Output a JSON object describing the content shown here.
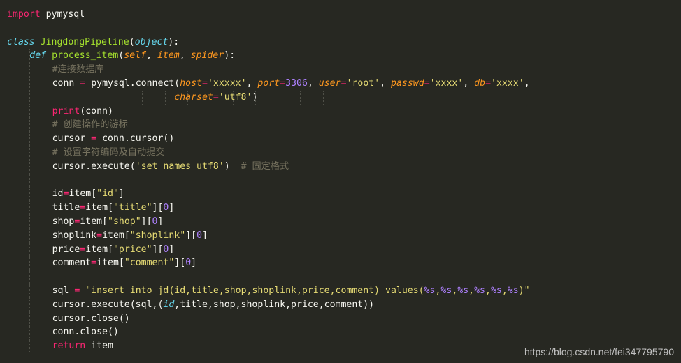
{
  "editor": {
    "theme_colors": {
      "background": "#272822",
      "default_text": "#f8f8f2",
      "keyword": "#f92672",
      "storage_type": "#66d9ef",
      "function_name": "#a6e22e",
      "parameter": "#fd971f",
      "string": "#e6db74",
      "number": "#ae81ff",
      "comment": "#75715e"
    },
    "lines": [
      {
        "indent": 0,
        "tokens": [
          [
            "kw",
            "import"
          ],
          [
            "txt",
            " pymysql"
          ]
        ]
      },
      {
        "indent": 0,
        "tokens": []
      },
      {
        "indent": 0,
        "tokens": [
          [
            "kwi",
            "class"
          ],
          [
            "txt",
            " "
          ],
          [
            "fn",
            "JingdongPipeline"
          ],
          [
            "txt",
            "("
          ],
          [
            "kwi",
            "object"
          ],
          [
            "txt",
            "):"
          ]
        ]
      },
      {
        "indent": 1,
        "tokens": [
          [
            "kwi",
            "def"
          ],
          [
            "txt",
            " "
          ],
          [
            "fn",
            "process_item"
          ],
          [
            "txt",
            "("
          ],
          [
            "par",
            "self"
          ],
          [
            "txt",
            ", "
          ],
          [
            "par",
            "item"
          ],
          [
            "txt",
            ", "
          ],
          [
            "par",
            "spider"
          ],
          [
            "txt",
            "):"
          ]
        ]
      },
      {
        "indent": 2,
        "tokens": [
          [
            "cmt",
            "#连接数据库"
          ]
        ]
      },
      {
        "indent": 2,
        "tokens": [
          [
            "txt",
            "conn "
          ],
          [
            "kw",
            "="
          ],
          [
            "txt",
            " pymysql.connect("
          ],
          [
            "par",
            "host"
          ],
          [
            "kw",
            "="
          ],
          [
            "str",
            "'xxxxx'"
          ],
          [
            "txt",
            ", "
          ],
          [
            "par",
            "port"
          ],
          [
            "kw",
            "="
          ],
          [
            "num",
            "3306"
          ],
          [
            "txt",
            ", "
          ],
          [
            "par",
            "user"
          ],
          [
            "kw",
            "="
          ],
          [
            "str",
            "'root'"
          ],
          [
            "txt",
            ", "
          ],
          [
            "par",
            "passwd"
          ],
          [
            "kw",
            "="
          ],
          [
            "str",
            "'xxxx'"
          ],
          [
            "txt",
            ", "
          ],
          [
            "par",
            "db"
          ],
          [
            "kw",
            "="
          ],
          [
            "str",
            "'xxxx'"
          ],
          [
            "txt",
            ","
          ]
        ]
      },
      {
        "indent": 2,
        "cont": true,
        "tokens": [
          [
            "txt",
            "                      "
          ],
          [
            "par",
            "charset"
          ],
          [
            "kw",
            "="
          ],
          [
            "str",
            "'utf8'"
          ],
          [
            "txt",
            ")"
          ]
        ]
      },
      {
        "indent": 2,
        "tokens": [
          [
            "kw",
            "print"
          ],
          [
            "txt",
            "(conn)"
          ]
        ]
      },
      {
        "indent": 2,
        "tokens": [
          [
            "cmt",
            "# 创建操作的游标"
          ]
        ]
      },
      {
        "indent": 2,
        "tokens": [
          [
            "txt",
            "cursor "
          ],
          [
            "kw",
            "="
          ],
          [
            "txt",
            " conn.cursor()"
          ]
        ]
      },
      {
        "indent": 2,
        "tokens": [
          [
            "cmt",
            "# 设置字符编码及自动提交"
          ]
        ]
      },
      {
        "indent": 2,
        "tokens": [
          [
            "txt",
            "cursor.execute("
          ],
          [
            "str",
            "'set names utf8'"
          ],
          [
            "txt",
            ")  "
          ],
          [
            "cmt",
            "# 固定格式"
          ]
        ]
      },
      {
        "indent": 1,
        "tokens": []
      },
      {
        "indent": 2,
        "tokens": [
          [
            "txt",
            "id"
          ],
          [
            "kw",
            "="
          ],
          [
            "txt",
            "item["
          ],
          [
            "str",
            "\"id\""
          ],
          [
            "txt",
            "]"
          ]
        ]
      },
      {
        "indent": 2,
        "tokens": [
          [
            "txt",
            "title"
          ],
          [
            "kw",
            "="
          ],
          [
            "txt",
            "item["
          ],
          [
            "str",
            "\"title\""
          ],
          [
            "txt",
            "]["
          ],
          [
            "num",
            "0"
          ],
          [
            "txt",
            "]"
          ]
        ]
      },
      {
        "indent": 2,
        "tokens": [
          [
            "txt",
            "shop"
          ],
          [
            "kw",
            "="
          ],
          [
            "txt",
            "item["
          ],
          [
            "str",
            "\"shop\""
          ],
          [
            "txt",
            "]["
          ],
          [
            "num",
            "0"
          ],
          [
            "txt",
            "]"
          ]
        ]
      },
      {
        "indent": 2,
        "tokens": [
          [
            "txt",
            "shoplink"
          ],
          [
            "kw",
            "="
          ],
          [
            "txt",
            "item["
          ],
          [
            "str",
            "\"shoplink\""
          ],
          [
            "txt",
            "]["
          ],
          [
            "num",
            "0"
          ],
          [
            "txt",
            "]"
          ]
        ]
      },
      {
        "indent": 2,
        "tokens": [
          [
            "txt",
            "price"
          ],
          [
            "kw",
            "="
          ],
          [
            "txt",
            "item["
          ],
          [
            "str",
            "\"price\""
          ],
          [
            "txt",
            "]["
          ],
          [
            "num",
            "0"
          ],
          [
            "txt",
            "]"
          ]
        ]
      },
      {
        "indent": 2,
        "tokens": [
          [
            "txt",
            "comment"
          ],
          [
            "kw",
            "="
          ],
          [
            "txt",
            "item["
          ],
          [
            "str",
            "\"comment\""
          ],
          [
            "txt",
            "]["
          ],
          [
            "num",
            "0"
          ],
          [
            "txt",
            "]"
          ]
        ]
      },
      {
        "indent": 1,
        "tokens": []
      },
      {
        "indent": 2,
        "tokens": [
          [
            "txt",
            "sql "
          ],
          [
            "kw",
            "="
          ],
          [
            "txt",
            " "
          ],
          [
            "str",
            "\"insert into jd(id,title,shop,shoplink,price,comment) values("
          ],
          [
            "num",
            "%s"
          ],
          [
            "str",
            ","
          ],
          [
            "num",
            "%s"
          ],
          [
            "str",
            ","
          ],
          [
            "num",
            "%s"
          ],
          [
            "str",
            ","
          ],
          [
            "num",
            "%s"
          ],
          [
            "str",
            ","
          ],
          [
            "num",
            "%s"
          ],
          [
            "str",
            ","
          ],
          [
            "num",
            "%s"
          ],
          [
            "str",
            ")\""
          ]
        ]
      },
      {
        "indent": 2,
        "tokens": [
          [
            "txt",
            "cursor.execute(sql,("
          ],
          [
            "kwi",
            "id"
          ],
          [
            "txt",
            ",title,shop,shoplink,price,comment))"
          ]
        ]
      },
      {
        "indent": 2,
        "tokens": [
          [
            "txt",
            "cursor.close()"
          ]
        ]
      },
      {
        "indent": 2,
        "tokens": [
          [
            "txt",
            "conn.close()"
          ]
        ]
      },
      {
        "indent": 2,
        "tokens": [
          [
            "kw",
            "return"
          ],
          [
            "txt",
            " item"
          ]
        ]
      }
    ]
  },
  "watermark": "https://blog.csdn.net/fei347795790"
}
